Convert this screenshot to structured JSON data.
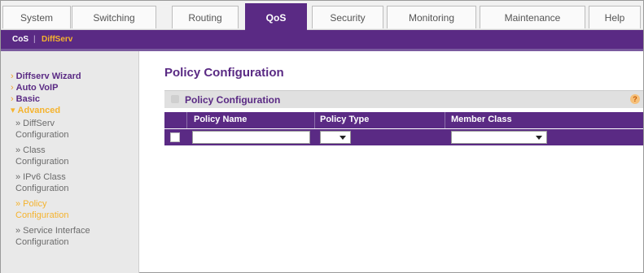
{
  "top_tabs": [
    {
      "label": "System",
      "active": false
    },
    {
      "label": "Switching",
      "active": false
    },
    {
      "label": "Routing",
      "active": false
    },
    {
      "label": "QoS",
      "active": true
    },
    {
      "label": "Security",
      "active": false
    },
    {
      "label": "Monitoring",
      "active": false
    },
    {
      "label": "Maintenance",
      "active": false
    },
    {
      "label": "Help",
      "active": false
    }
  ],
  "subnav": {
    "cos": "CoS",
    "separator": "|",
    "diffserv": "DiffServ"
  },
  "sidebar": {
    "items": [
      {
        "label": "Diffserv Wizard"
      },
      {
        "label": "Auto VoIP"
      },
      {
        "label": "Basic"
      },
      {
        "label": "Advanced"
      }
    ],
    "subitems": [
      {
        "line1": "DiffServ",
        "line2": "Configuration"
      },
      {
        "line1": "Class",
        "line2": "Configuration"
      },
      {
        "line1": "IPv6 Class",
        "line2": "Configuration"
      },
      {
        "line1": "Policy",
        "line2": "Configuration"
      },
      {
        "line1": "Service Interface",
        "line2": "Configuration"
      }
    ],
    "arrow": "›",
    "down_arrow": "▾",
    "bullet": "»"
  },
  "main": {
    "page_title": "Policy Configuration",
    "panel_title": "Policy Configuration",
    "help_icon": "?",
    "columns": [
      "Policy Name",
      "Policy Type",
      "Member Class"
    ],
    "row": {
      "policy_name": "",
      "policy_type": "",
      "member_class": ""
    }
  },
  "colors": {
    "accent": "#5a2a84",
    "highlight": "#f5b32e"
  }
}
